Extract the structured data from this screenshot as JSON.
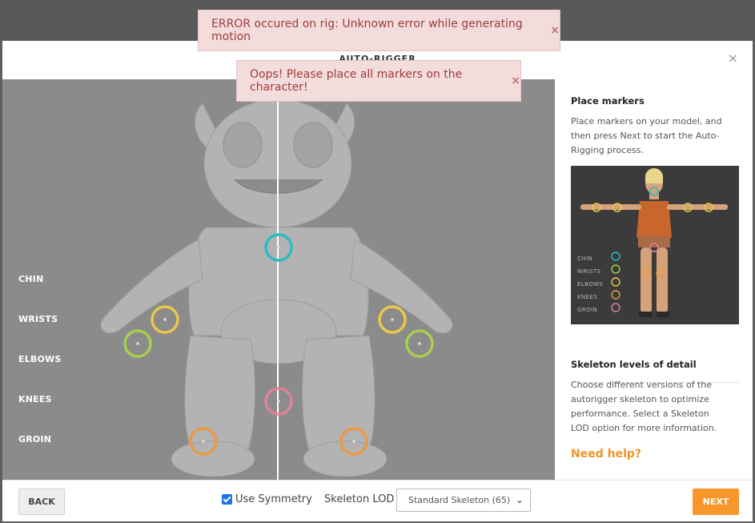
{
  "modal": {
    "title": "AUTO-RIGGER",
    "close": "×"
  },
  "markers": {
    "labels": [
      "CHIN",
      "WRISTS",
      "ELBOWS",
      "KNEES",
      "GROIN"
    ],
    "colors": {
      "chin": "#2bbcc4",
      "wrists": "#a8cf4e",
      "elbows": "#e8c84a",
      "knees": "#e99a45",
      "groin": "#e3819a"
    }
  },
  "side": {
    "place_title": "Place markers",
    "place_text": "Place markers on your model, and then press Next to start the Auto-Rigging process.",
    "reference_legend": [
      "CHIN",
      "WRISTS",
      "ELBOWS",
      "KNEES",
      "GROIN"
    ],
    "lod_title": "Skeleton levels of detail",
    "lod_text": "Choose different versions of the autorigger skeleton to optimize performance. Select a Skeleton LOD option for more information.",
    "help_link": "Need help?"
  },
  "footer": {
    "back_label": "BACK",
    "symmetry_label": "Use Symmetry",
    "symmetry_checked": true,
    "lod_label": "Skeleton LOD",
    "lod_selected": "Standard Skeleton (65)",
    "next_label": "NEXT"
  },
  "toasts": [
    {
      "message": "ERROR occured on rig: Unknown error while generating motion",
      "close": "×"
    },
    {
      "message": "Oops! Please place all markers on the character!",
      "close": "×"
    }
  ]
}
